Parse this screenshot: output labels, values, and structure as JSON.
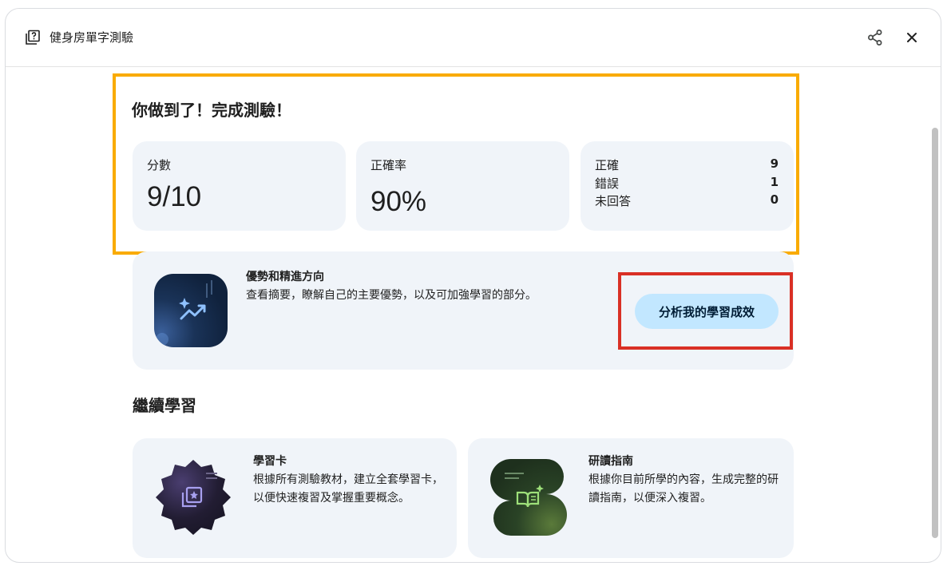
{
  "header": {
    "title": "健身房單字測驗",
    "quiz_icon": "quiz-icon",
    "share_icon": "share-icon",
    "close_icon": "close-icon"
  },
  "result": {
    "title": "你做到了！完成測驗！",
    "score": {
      "label": "分數",
      "value": "9/10"
    },
    "accuracy": {
      "label": "正確率",
      "value": "90%"
    },
    "breakdown": [
      {
        "label": "正確",
        "value": "9"
      },
      {
        "label": "錯誤",
        "value": "1"
      },
      {
        "label": "未回答",
        "value": "0"
      }
    ]
  },
  "strengths": {
    "title": "優勢和精進方向",
    "description": "查看摘要，瞭解自己的主要優勢，以及可加強學習的部分。",
    "button_label": "分析我的學習成效",
    "icon": "trending-up-sparkle-icon"
  },
  "continue": {
    "heading": "繼續學習",
    "cards": [
      {
        "title": "學習卡",
        "description": "根據所有測驗教材，建立全套學習卡，以便快速複習及掌握重要概念。",
        "icon": "flashcards-icon"
      },
      {
        "title": "研讀指南",
        "description": "根據你目前所學的內容，生成完整的研讀指南，以便深入複習。",
        "icon": "study-guide-icon"
      }
    ]
  },
  "colors": {
    "card_bg": "#f0f4f9",
    "button_bg": "#c2e7ff",
    "highlight_orange": "#f9ab00",
    "highlight_red": "#d93025"
  }
}
